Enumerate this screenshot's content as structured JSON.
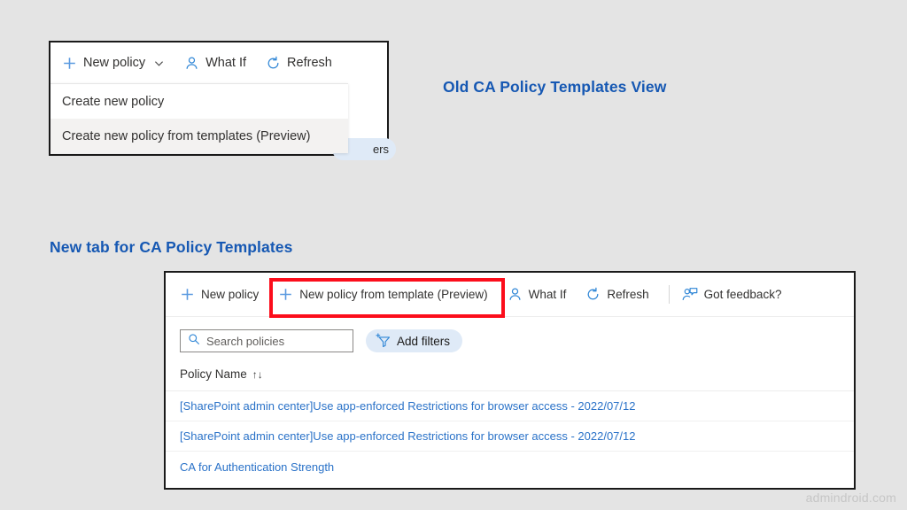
{
  "annotations": {
    "old_view_caption": "Old CA Policy Templates View",
    "new_tab_caption": "New tab for CA Policy Templates",
    "highlight_color": "#fc0d1b",
    "caption_color": "#1658b3"
  },
  "old_panel": {
    "toolbar": [
      {
        "icon": "plus-icon",
        "label": "New policy",
        "has_chevron": true
      },
      {
        "icon": "person-icon",
        "label": "What If",
        "has_chevron": false
      },
      {
        "icon": "refresh-icon",
        "label": "Refresh",
        "has_chevron": false
      }
    ],
    "chevron_glyph": "⌄",
    "dropdown": {
      "items": [
        {
          "label": "Create new policy",
          "hovered": false
        },
        {
          "label": "Create new policy from templates (Preview)",
          "hovered": true
        }
      ]
    },
    "background_pill_text": "ers"
  },
  "new_panel": {
    "toolbar": [
      {
        "icon": "plus-icon",
        "label": "New policy",
        "highlighted": false
      },
      {
        "icon": "plus-icon",
        "label": "New policy from template (Preview)",
        "highlighted": true
      },
      {
        "icon": "person-icon",
        "label": "What If",
        "highlighted": false
      },
      {
        "icon": "refresh-icon",
        "label": "Refresh",
        "highlighted": false
      },
      {
        "icon": "feedback-person-icon",
        "label": "Got feedback?",
        "highlighted": false
      }
    ],
    "search": {
      "placeholder": "Search policies",
      "value": "",
      "icon": "search-icon"
    },
    "add_filters": {
      "label": "Add filters",
      "icon": "add-filter-icon"
    },
    "table": {
      "columns": [
        {
          "label": "Policy Name",
          "sort_glyph": "↑↓"
        }
      ],
      "rows": [
        {
          "policy_name": "[SharePoint admin center]Use app-enforced Restrictions for browser access - 2022/07/12"
        },
        {
          "policy_name": "[SharePoint admin center]Use app-enforced Restrictions for browser access - 2022/07/12"
        },
        {
          "policy_name": "CA for Authentication Strength"
        }
      ]
    }
  },
  "watermark": {
    "text": "admindroid.com"
  }
}
